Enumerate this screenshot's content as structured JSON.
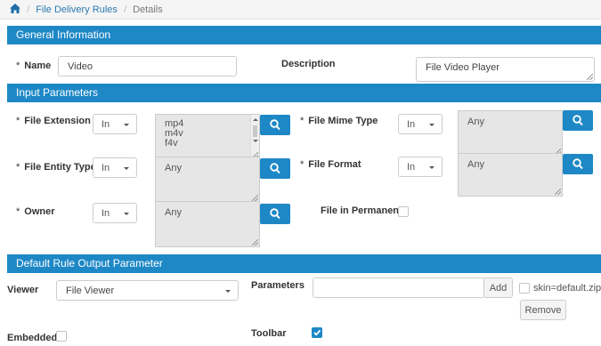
{
  "breadcrumb": {
    "items": [
      "File Delivery Rules",
      "Details"
    ]
  },
  "sections": {
    "general": "General Information",
    "input": "Input Parameters",
    "output": "Default Rule Output Parameter"
  },
  "general": {
    "name_label": "Name",
    "name_value": "Video",
    "description_label": "Description",
    "description_value": "File Video Player"
  },
  "input": {
    "file_extension": {
      "label": "File Extension",
      "operator": "In",
      "values": [
        "mp4",
        "m4v",
        "f4v"
      ]
    },
    "file_mime_type": {
      "label": "File Mime Type",
      "operator": "In",
      "value": "Any"
    },
    "file_entity_type": {
      "label": "File Entity Type",
      "operator": "In",
      "value": "Any"
    },
    "file_format": {
      "label": "File Format",
      "operator": "In",
      "value": "Any"
    },
    "owner": {
      "label": "Owner",
      "operator": "In",
      "value": "Any"
    },
    "file_in_permanent": {
      "label": "File in Permanent",
      "checked": false
    }
  },
  "output": {
    "viewer_label": "Viewer",
    "viewer_value": "File Viewer",
    "parameters_label": "Parameters",
    "parameters_value": "",
    "add_label": "Add",
    "param_item": "skin=default.zip",
    "remove_label": "Remove",
    "embedded_label": "Embedded",
    "embedded_checked": false,
    "toolbar_label": "Toolbar",
    "toolbar_checked": true
  },
  "icons": {
    "home": "home-icon",
    "search": "search-icon",
    "caret": "chevron-down-icon",
    "check": "check-icon"
  },
  "colors": {
    "accent": "#1e88c6",
    "readonly": "#e6e6e6"
  }
}
